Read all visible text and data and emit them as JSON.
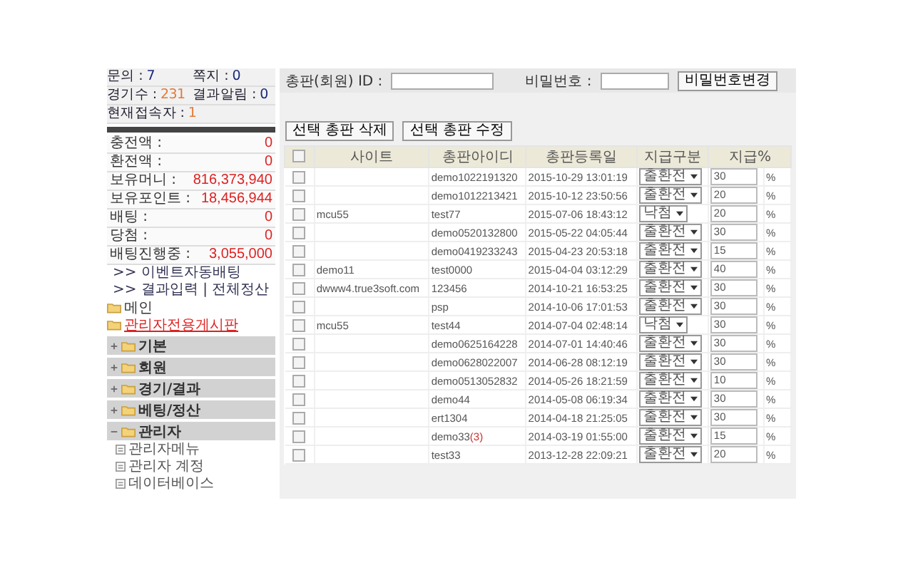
{
  "sidebar": {
    "stat_rows": [
      [
        {
          "label": "문의 : ",
          "value": "7",
          "color": "#1a2a7a"
        },
        {
          "label": "쪽지 : ",
          "value": "0",
          "color": "#1a2a7a"
        }
      ],
      [
        {
          "label": "경기수 : ",
          "value": "231",
          "color": "#e07a3a"
        },
        {
          "label": "결과알림 : ",
          "value": "0",
          "color": "#1a2a7a"
        }
      ],
      [
        {
          "label": "현재접속자 : ",
          "value": "1",
          "color": "#e07a3a"
        }
      ]
    ],
    "balances": [
      {
        "label": "충전액 :",
        "value": "0"
      },
      {
        "label": "환전액 :",
        "value": "0"
      },
      {
        "label": "보유머니 :",
        "value": "816,373,940"
      },
      {
        "label": "보유포인트 :",
        "value": "18,456,944"
      },
      {
        "label": "배팅 :",
        "value": "0"
      },
      {
        "label": "당첨 :",
        "value": "0"
      },
      {
        "label": "배팅진행중 :",
        "value": "3,055,000"
      }
    ],
    "links": [
      ">> 이벤트자동배팅",
      ">> 결과입력 | 전체정산"
    ],
    "menu": [
      {
        "label": "메인",
        "kind": "plain"
      },
      {
        "label": "관리자전용게시판",
        "kind": "highlight"
      }
    ],
    "sections": [
      {
        "label": "기본",
        "expanded": false
      },
      {
        "label": "회원",
        "expanded": false
      },
      {
        "label": "경기/결과",
        "expanded": false
      },
      {
        "label": "베팅/정산",
        "expanded": false
      },
      {
        "label": "관리자",
        "expanded": true,
        "children": [
          "관리자메뉴",
          "관리자 계정",
          "데이터베이스"
        ]
      }
    ]
  },
  "search": {
    "id_label": "총판(회원) ID :",
    "password_label": "비밀번호 :",
    "button": "비밀번호변경"
  },
  "actions": [
    "선택 총판 삭제",
    "선택 총판 수정"
  ],
  "table": {
    "header_checked": false,
    "columns": [
      "사이트",
      "총판아이디",
      "총판등록일",
      "지급구분",
      "지급%"
    ],
    "rows": [
      {
        "checked": false,
        "site": "",
        "id": "demo1022191320",
        "date": "2015-10-29 13:01:19",
        "type": "출환전",
        "pct": "30",
        "unit": "%"
      },
      {
        "checked": false,
        "site": "",
        "id": "demo1012213421",
        "date": "2015-10-12 23:50:56",
        "type": "출환전",
        "pct": "20",
        "unit": "%"
      },
      {
        "checked": false,
        "site": "mcu55",
        "id": "test77",
        "date": "2015-07-06 18:43:12",
        "type": "낙첨",
        "pct": "20",
        "unit": "%"
      },
      {
        "checked": false,
        "site": "",
        "id": "demo0520132800",
        "date": "2015-05-22 04:05:44",
        "type": "출환전",
        "pct": "30",
        "unit": "%"
      },
      {
        "checked": false,
        "site": "",
        "id": "demo0419233243",
        "date": "2015-04-23 20:53:18",
        "type": "출환전",
        "pct": "15",
        "unit": "%"
      },
      {
        "checked": false,
        "site": "demo11",
        "id": "test0000",
        "date": "2015-04-04 03:12:29",
        "type": "출환전",
        "pct": "40",
        "unit": "%"
      },
      {
        "checked": false,
        "site": "dwww4.true3soft.com",
        "id": "123456",
        "date": "2014-10-21 16:53:25",
        "type": "출환전",
        "pct": "30",
        "unit": "%"
      },
      {
        "checked": false,
        "site": "",
        "id": "psp",
        "date": "2014-10-06 17:01:53",
        "type": "출환전",
        "pct": "30",
        "unit": "%"
      },
      {
        "checked": false,
        "site": "mcu55",
        "id": "test44",
        "date": "2014-07-04 02:48:14",
        "type": "낙첨",
        "pct": "30",
        "unit": "%"
      },
      {
        "checked": false,
        "site": "",
        "id": "demo0625164228",
        "date": "2014-07-01 14:40:46",
        "type": "출환전",
        "pct": "30",
        "unit": "%"
      },
      {
        "checked": false,
        "site": "",
        "id": "demo0628022007",
        "date": "2014-06-28 08:12:19",
        "type": "출환전",
        "pct": "30",
        "unit": "%"
      },
      {
        "checked": false,
        "site": "",
        "id": "demo0513052832",
        "date": "2014-05-26 18:21:59",
        "type": "출환전",
        "pct": "10",
        "unit": "%"
      },
      {
        "checked": false,
        "site": "",
        "id": "demo44",
        "date": "2014-05-08 06:19:34",
        "type": "출환전",
        "pct": "30",
        "unit": "%"
      },
      {
        "checked": false,
        "site": "",
        "id": "ert1304",
        "date": "2014-04-18 21:25:05",
        "type": "출환전",
        "pct": "30",
        "unit": "%"
      },
      {
        "checked": false,
        "site": "",
        "id": "demo33",
        "count": "(3)",
        "date": "2014-03-19 01:55:00",
        "type": "출환전",
        "pct": "15",
        "unit": "%"
      },
      {
        "checked": false,
        "site": "",
        "id": "test33",
        "date": "2013-12-28 22:09:21",
        "type": "출환전",
        "pct": "20",
        "unit": "%"
      }
    ]
  }
}
